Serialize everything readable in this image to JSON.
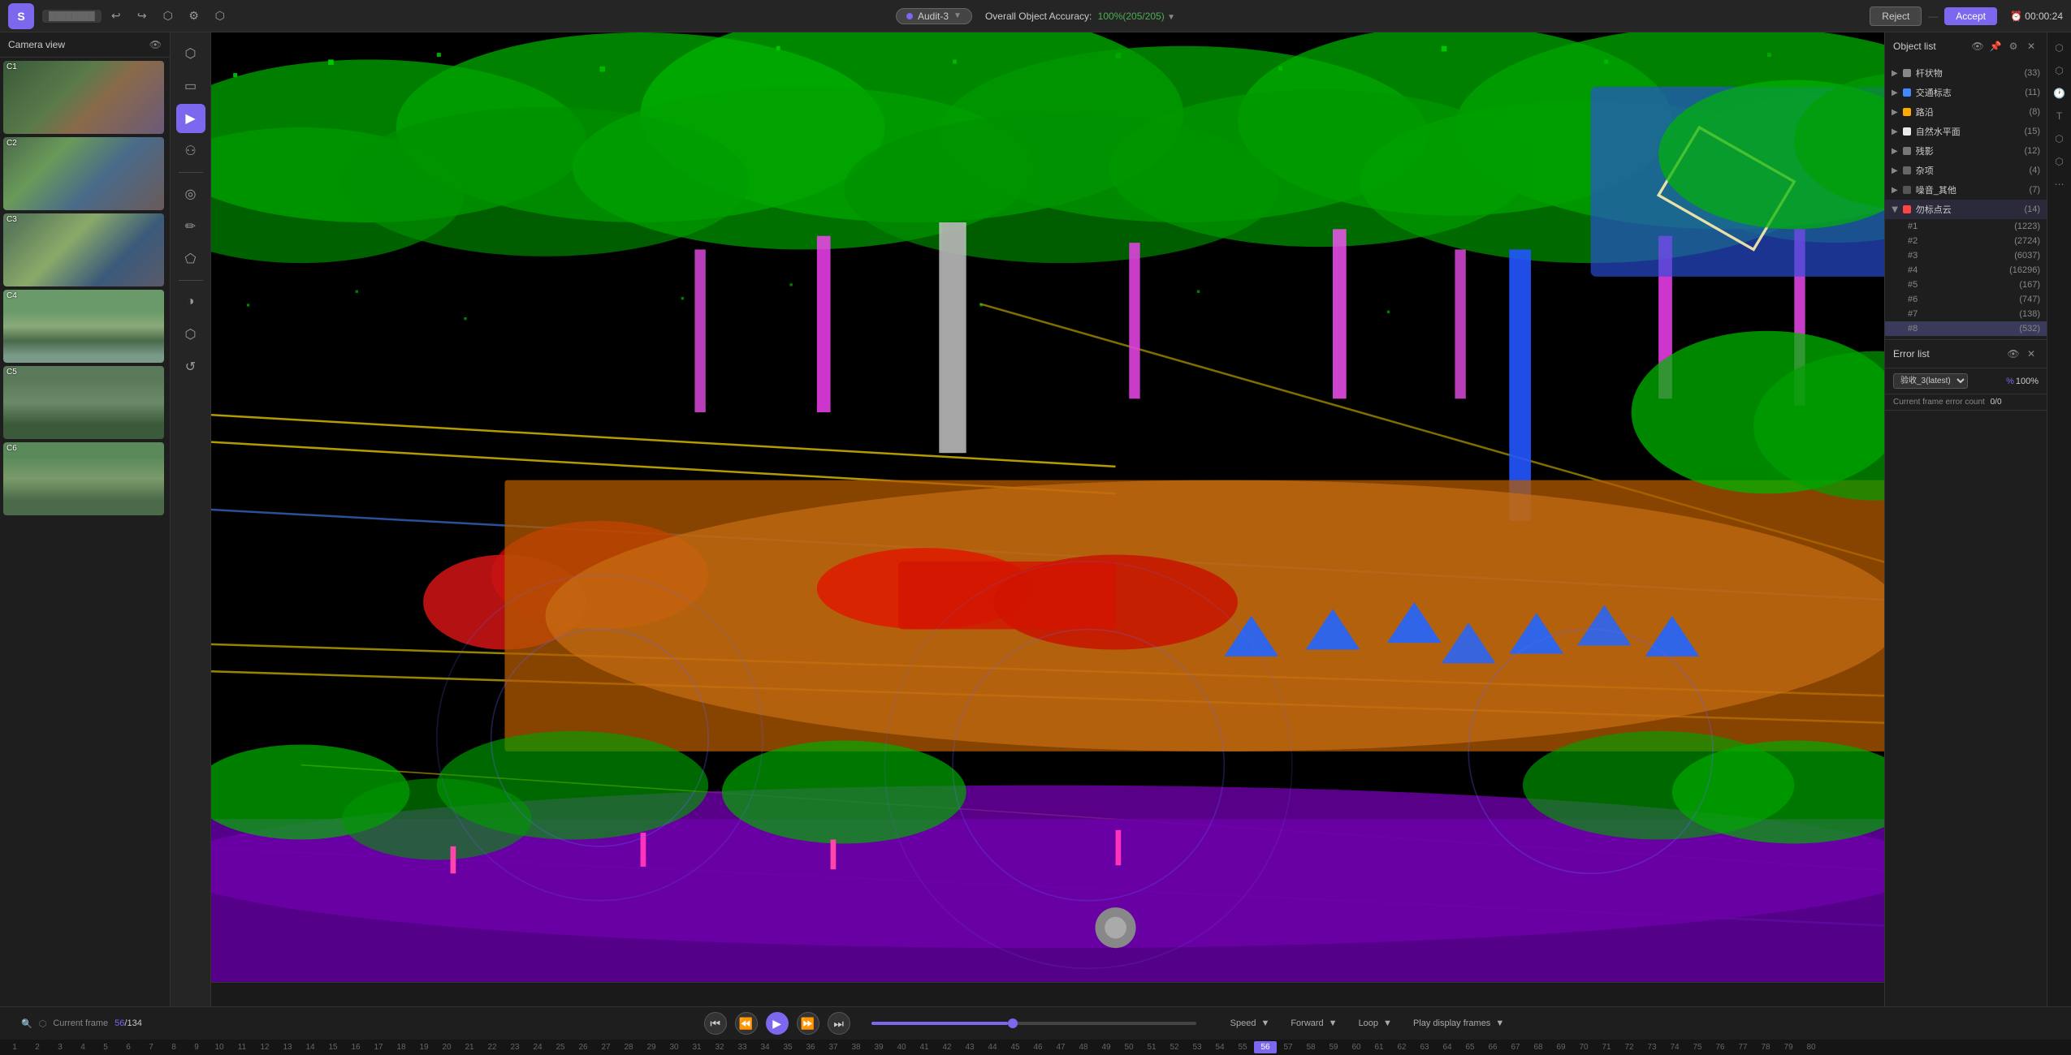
{
  "app": {
    "logo": "S",
    "project_name": "Project",
    "title": "Audit-3"
  },
  "topbar": {
    "audit_label": "Audit-3",
    "accuracy_label": "Overall Object Accuracy:",
    "accuracy_value": "100%(205/205)",
    "reject_label": "Reject",
    "accept_label": "Accept",
    "timer": "00:00:24",
    "undo_icon": "↩",
    "redo_icon": "↪",
    "save_icon": "💾",
    "settings_icon": "⚙",
    "info_icon": "ℹ"
  },
  "camera_view": {
    "title": "Camera view",
    "cameras": [
      {
        "id": "C1",
        "label": "C1"
      },
      {
        "id": "C2",
        "label": "C2"
      },
      {
        "id": "C3",
        "label": "C3"
      },
      {
        "id": "C4",
        "label": "C4"
      },
      {
        "id": "C5",
        "label": "C5"
      },
      {
        "id": "C6",
        "label": "C6"
      }
    ]
  },
  "toolbar": {
    "tools": [
      {
        "id": "select",
        "icon": "⬡",
        "label": "select"
      },
      {
        "id": "rect",
        "icon": "▭",
        "label": "rectangle"
      },
      {
        "id": "pointer",
        "icon": "▶",
        "label": "pointer",
        "active": true
      },
      {
        "id": "person",
        "icon": "⚇",
        "label": "person"
      },
      {
        "id": "circle",
        "icon": "◎",
        "label": "circle"
      },
      {
        "id": "pencil",
        "icon": "✏",
        "label": "pencil"
      },
      {
        "id": "polygon",
        "icon": "⬠",
        "label": "polygon"
      },
      {
        "id": "contrast",
        "icon": "◑",
        "label": "contrast"
      },
      {
        "id": "cube",
        "icon": "⬡",
        "label": "cube"
      },
      {
        "id": "refresh",
        "icon": "↺",
        "label": "refresh"
      }
    ]
  },
  "object_list": {
    "title": "Object list",
    "categories": [
      {
        "id": "cat1",
        "name": "杆状物",
        "count": 33,
        "color": "#888888",
        "expanded": false
      },
      {
        "id": "cat2",
        "name": "交通标志",
        "count": 11,
        "color": "#4488ff",
        "expanded": false
      },
      {
        "id": "cat3",
        "name": "路沿",
        "count": 8,
        "color": "#ffaa00",
        "expanded": false
      },
      {
        "id": "cat4",
        "name": "自然水平面",
        "count": 15,
        "color": "#ffffff",
        "expanded": false
      },
      {
        "id": "cat5",
        "name": "残影",
        "count": 12,
        "color": "#888888",
        "expanded": false
      },
      {
        "id": "cat6",
        "name": "杂项",
        "count": 4,
        "color": "#888888",
        "expanded": false
      },
      {
        "id": "cat7",
        "name": "噪音_其他",
        "count": 7,
        "color": "#888888",
        "expanded": false
      },
      {
        "id": "cat8",
        "name": "勿标点云",
        "count": 14,
        "color": "#ff4444",
        "expanded": true
      }
    ],
    "items": [
      {
        "id": "#1",
        "count": 1223,
        "active": false
      },
      {
        "id": "#2",
        "count": 2724,
        "active": false
      },
      {
        "id": "#3",
        "count": 6037,
        "active": false
      },
      {
        "id": "#4",
        "count": 16296,
        "active": false
      },
      {
        "id": "#5",
        "count": 167,
        "active": false
      },
      {
        "id": "#6",
        "count": 747,
        "active": false
      },
      {
        "id": "#7",
        "count": 138,
        "active": false
      },
      {
        "id": "#8",
        "count": 532,
        "active": true
      }
    ]
  },
  "error_list": {
    "title": "Error list",
    "selected_audit": "验收_3(latest)",
    "percentage": "100%",
    "current_frame_error": "Current frame error count",
    "error_count": "0/0"
  },
  "playback": {
    "speed_label": "Speed",
    "forward_label": "Forward",
    "loop_label": "Loop",
    "play_display_label": "Play display frames",
    "current_frame": "56",
    "total_frames": "134",
    "frame_label": "Current frame",
    "progress_pct": 42
  },
  "frame_numbers": [
    1,
    2,
    3,
    4,
    5,
    6,
    7,
    8,
    9,
    10,
    11,
    12,
    13,
    14,
    15,
    16,
    17,
    18,
    19,
    20,
    21,
    22,
    23,
    24,
    25,
    26,
    27,
    28,
    29,
    30,
    31,
    32,
    33,
    34,
    35,
    36,
    37,
    38,
    39,
    40,
    41,
    42,
    43,
    44,
    45,
    46,
    47,
    48,
    49,
    50,
    51,
    52,
    53,
    54,
    55,
    56,
    57,
    58,
    59,
    60,
    61,
    62,
    63,
    64,
    65,
    66,
    67,
    68,
    69,
    70,
    71,
    72,
    73,
    74,
    75,
    76,
    77,
    78,
    79,
    80
  ],
  "colors": {
    "accent": "#7B68EE",
    "bg_dark": "#1a1a1a",
    "bg_panel": "#1e1e1e",
    "border": "#333333",
    "text_primary": "#cccccc",
    "text_secondary": "#888888"
  }
}
